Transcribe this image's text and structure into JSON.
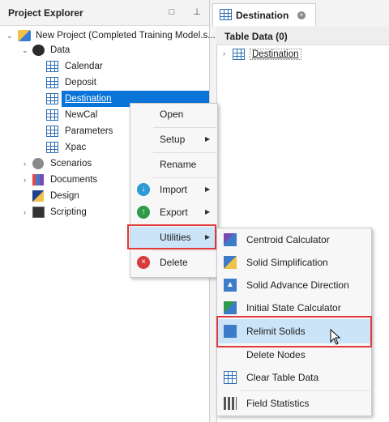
{
  "explorer": {
    "title": "Project Explorer",
    "tree": {
      "project": "New Project (Completed Training Model.s...",
      "data": "Data",
      "tables": [
        "Calendar",
        "Deposit",
        "Destination",
        "NewCal",
        "Parameters",
        "Xpac"
      ],
      "scenarios": "Scenarios",
      "documents": "Documents",
      "design": "Design",
      "scripting": "Scripting"
    }
  },
  "document": {
    "tab_title": "Destination",
    "header": "Table Data (0)",
    "row_label": "Destination"
  },
  "context_menu": {
    "open": "Open",
    "setup": "Setup",
    "rename": "Rename",
    "import": "Import",
    "export": "Export",
    "utilities": "Utilities",
    "delete": "Delete"
  },
  "utilities_menu": {
    "items": [
      "Centroid Calculator",
      "Solid Simplification",
      "Solid Advance Direction",
      "Initial State Calculator",
      "Relimit Solids",
      "Delete Nodes",
      "Clear Table Data",
      "Field Statistics"
    ]
  },
  "colors": {
    "selection": "#0a74d9",
    "highlight": "#cce4f7",
    "callout": "#e0393b"
  }
}
